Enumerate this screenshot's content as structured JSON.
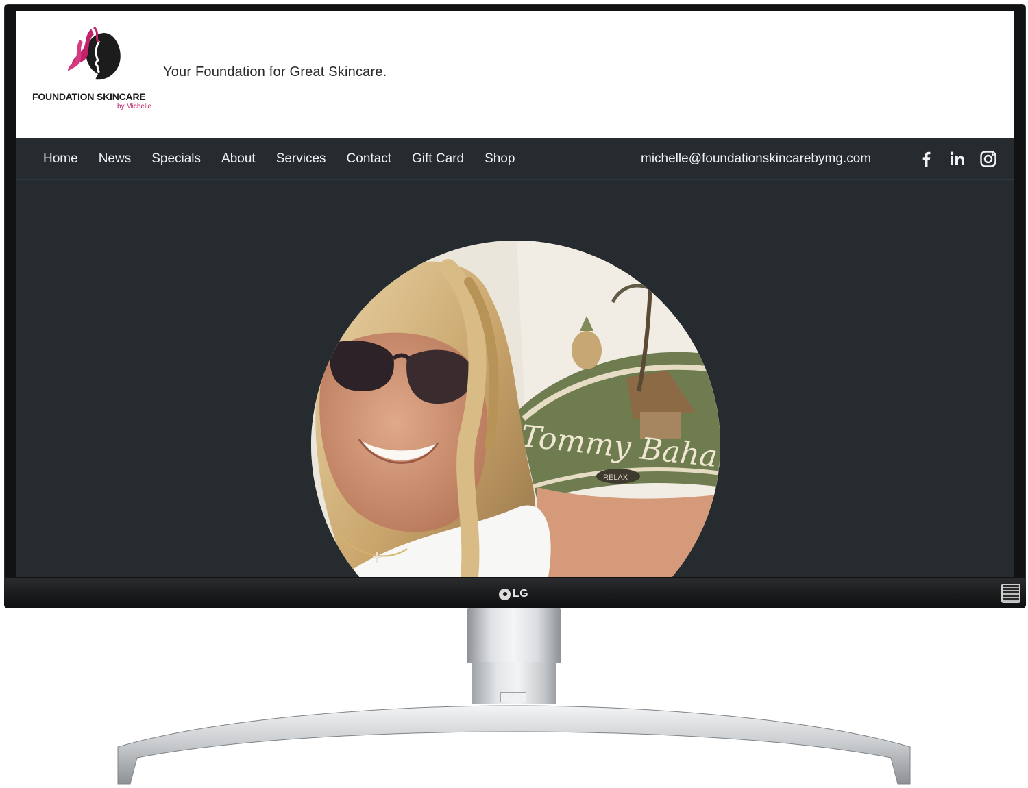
{
  "site": {
    "logo": {
      "name": "FOUNDATION SKINCARE",
      "byline": "by Michelle",
      "colors": {
        "accent": "#c3226a",
        "dark": "#1b1b1b"
      }
    },
    "tagline": "Your Foundation for Great Skincare."
  },
  "nav": {
    "items": [
      {
        "label": "Home"
      },
      {
        "label": "News"
      },
      {
        "label": "Specials"
      },
      {
        "label": "About"
      },
      {
        "label": "Services"
      },
      {
        "label": "Contact"
      },
      {
        "label": "Gift Card"
      },
      {
        "label": "Shop"
      }
    ],
    "email": "michelle@foundationskincarebymg.com",
    "social": [
      "facebook-icon",
      "linkedin-icon",
      "instagram-icon"
    ]
  },
  "hero": {
    "photo_shirt_text": "Tommy Bahar",
    "photo_tag_text": "RELAX"
  },
  "monitor": {
    "brand": "LG"
  },
  "colors": {
    "nav_bg": "#262b30",
    "page_bg": "#262b30",
    "header_bg": "#ffffff",
    "nav_text": "#f2f2f2"
  }
}
